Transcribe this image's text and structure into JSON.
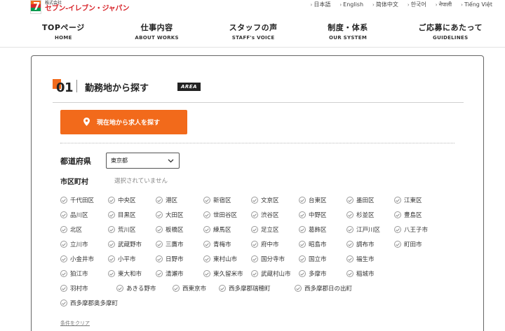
{
  "brand": {
    "logo_small": "株式会社",
    "logo_name": "セブン-イレブン・ジャパン",
    "logo_mark": "7"
  },
  "languages": [
    {
      "label": "日本語"
    },
    {
      "label": "English"
    },
    {
      "label": "简体中文"
    },
    {
      "label": "한국어"
    },
    {
      "label": "नेपाली"
    },
    {
      "label": "Tiếng Việt"
    }
  ],
  "nav": [
    {
      "jp": "TOPページ",
      "en": "HOME"
    },
    {
      "jp": "仕事内容",
      "en": "ABOUT WORKS"
    },
    {
      "jp": "スタッフの声",
      "en": "STAFF's VOICE"
    },
    {
      "jp": "制度・体系",
      "en": "OUR SYSTEM"
    },
    {
      "jp": "ご応募にあたって",
      "en": "GUIDELINES"
    }
  ],
  "section": {
    "number": "01",
    "title": "勤務地から探す",
    "tag": "AREA"
  },
  "locate_button": "現在地から求人を探す",
  "prefecture": {
    "label": "都道府県",
    "selected": "東京都"
  },
  "city": {
    "label": "市区町村",
    "none_selected": "選択されていません"
  },
  "ward_rows": [
    [
      "千代田区",
      "中央区",
      "港区",
      "新宿区",
      "文京区",
      "台東区",
      "墨田区",
      "江東区"
    ],
    [
      "品川区",
      "目黒区",
      "大田区",
      "世田谷区",
      "渋谷区",
      "中野区",
      "杉並区",
      "豊島区"
    ],
    [
      "北区",
      "荒川区",
      "板橋区",
      "練馬区",
      "足立区",
      "葛飾区",
      "江戸川区",
      "八王子市"
    ],
    [
      "立川市",
      "武蔵野市",
      "三鷹市",
      "青梅市",
      "府中市",
      "昭島市",
      "調布市",
      "町田市"
    ],
    [
      "小金井市",
      "小平市",
      "日野市",
      "東村山市",
      "国分寺市",
      "国立市",
      "福生市"
    ],
    [
      "狛江市",
      "東大和市",
      "清瀬市",
      "東久留米市",
      "武蔵村山市",
      "多摩市",
      "稲城市"
    ],
    [
      "羽村市",
      "あきる野市",
      "西東京市",
      "西多摩郡瑞穂町",
      "西多摩郡日の出町"
    ],
    [
      "西多摩郡奥多摩町"
    ]
  ],
  "clear_link": "条件をクリア",
  "colors": {
    "accent": "#f26a1b",
    "brand_red": "#d8262c",
    "brand_green": "#009a4e"
  }
}
